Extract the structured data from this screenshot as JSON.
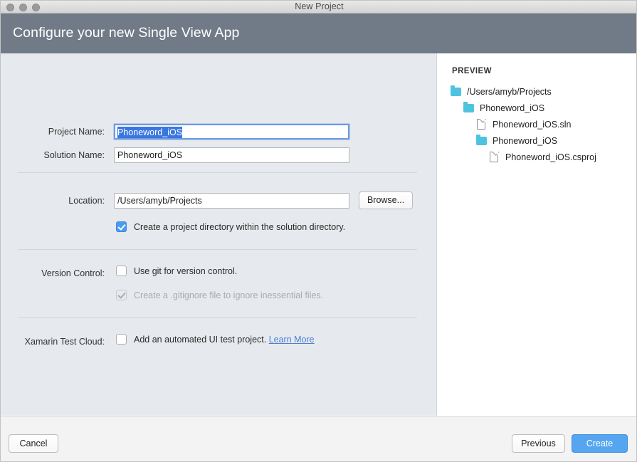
{
  "window": {
    "title": "New Project",
    "traffic_lights": [
      "close-button",
      "minimize-button",
      "zoom-button"
    ]
  },
  "header": {
    "title": "Configure your new Single View App"
  },
  "form": {
    "project_name": {
      "label": "Project Name:",
      "value": "Phoneword_iOS",
      "selected": true,
      "focused": true
    },
    "solution_name": {
      "label": "Solution Name:",
      "value": "Phoneword_iOS"
    },
    "location": {
      "label": "Location:",
      "value": "/Users/amyb/Projects",
      "browse_label": "Browse..."
    },
    "project_directory": {
      "label": "Create a project directory within the solution directory.",
      "checked": true,
      "enabled": true
    },
    "version_control": {
      "label": "Version Control:",
      "use_git": {
        "label": "Use git for version control.",
        "checked": false,
        "enabled": true
      },
      "gitignore": {
        "label": "Create a .gitignore file to ignore inessential files.",
        "checked": true,
        "enabled": false
      }
    },
    "xamarin_test_cloud": {
      "label": "Xamarin Test Cloud:",
      "ui_test": {
        "label": "Add an automated UI test project.",
        "checked": false,
        "enabled": true
      },
      "learn_more_label": "Learn More"
    }
  },
  "preview": {
    "title": "PREVIEW",
    "tree": [
      {
        "label": "/Users/amyb/Projects",
        "type": "folder",
        "depth": 0
      },
      {
        "label": "Phoneword_iOS",
        "type": "folder",
        "depth": 1
      },
      {
        "label": "Phoneword_iOS.sln",
        "type": "file",
        "depth": 2
      },
      {
        "label": "Phoneword_iOS",
        "type": "folder",
        "depth": 2
      },
      {
        "label": "Phoneword_iOS.csproj",
        "type": "file",
        "depth": 3
      }
    ]
  },
  "footer": {
    "cancel_label": "Cancel",
    "previous_label": "Previous",
    "create_label": "Create"
  },
  "colors": {
    "header_band": "#717b87",
    "form_background": "#e6e9ed",
    "accent_blue": "#55a5f0",
    "checkbox_blue": "#4a9bf2",
    "folder_cyan": "#4ec3e0",
    "link_blue": "#4d7fd4",
    "selection_blue": "#3a76e0"
  }
}
